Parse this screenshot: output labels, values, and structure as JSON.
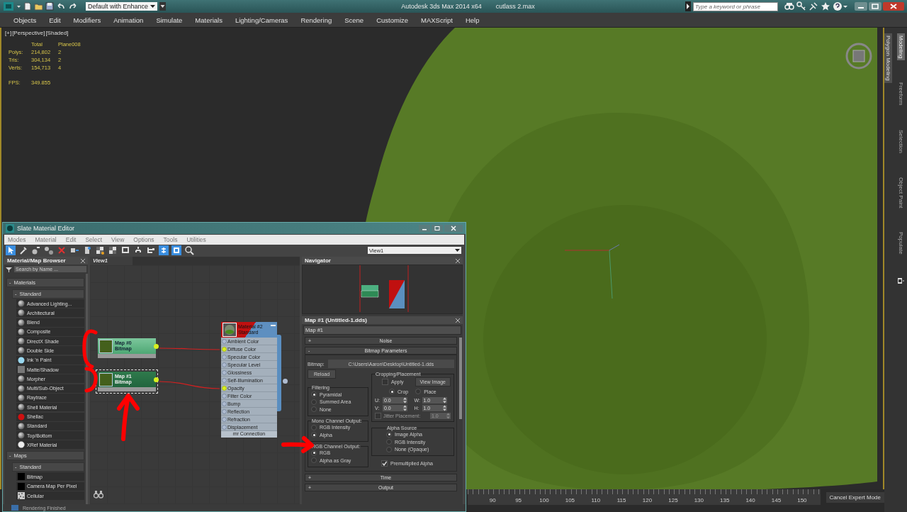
{
  "title_bar": {
    "workspace": "Default with Enhance",
    "title": "Autodesk 3ds Max  2014 x64",
    "file": "cutlass 2.max",
    "search": {
      "placeholder": "Type a keyword or phrase"
    }
  },
  "menu_bar": [
    "Objects",
    "Edit",
    "Modifiers",
    "Animation",
    "Simulate",
    "Materials",
    "Lighting/Cameras",
    "Rendering",
    "Scene",
    "Customize",
    "MAXScript",
    "Help"
  ],
  "viewport": {
    "labels": [
      "[+]",
      "[Perspective]",
      "[Shaded]"
    ],
    "stats": {
      "columns": [
        "Total",
        "Plane008"
      ],
      "rows": [
        {
          "label": "Polys:",
          "total": "214,802",
          "selection": "2"
        },
        {
          "label": "Tris:",
          "total": "304,134",
          "selection": "2"
        },
        {
          "label": "Verts:",
          "total": "154,713",
          "selection": "4"
        }
      ]
    },
    "fps": {
      "label": "FPS:",
      "value": "349.855"
    }
  },
  "ribbon_panel": "Polygon Modeling",
  "command_tabs": [
    {
      "label": "Modeling",
      "selected": true
    },
    {
      "label": "Freeform",
      "selected": false
    },
    {
      "label": "Selection",
      "selected": false
    },
    {
      "label": "Object Paint",
      "selected": false
    },
    {
      "label": "Populate",
      "selected": false
    }
  ],
  "timeline": {
    "ticks": [
      "90",
      "95",
      "100",
      "105",
      "110",
      "115",
      "120",
      "125",
      "130",
      "135",
      "140",
      "145",
      "150"
    ]
  },
  "expert_mode_button": "Cancel Expert Mode",
  "material_editor": {
    "title": "Slate Material Editor",
    "menu": [
      "Modes",
      "Material",
      "Edit",
      "Select",
      "View",
      "Options",
      "Tools",
      "Utilities"
    ],
    "view_dropdown": "View1",
    "browser": {
      "title": "Material/Map Browser",
      "search_placeholder": "Search by Name ...",
      "tree": [
        {
          "label": "Materials",
          "sign": "-",
          "children": [
            {
              "label": "Standard",
              "sign": "-",
              "children": [
                {
                  "label": "Advanced Lighting...",
                  "kind": "sphere"
                },
                {
                  "label": "Architectural",
                  "kind": "sphere"
                },
                {
                  "label": "Blend",
                  "kind": "sphere"
                },
                {
                  "label": "Composite",
                  "kind": "sphere"
                },
                {
                  "label": "DirectX Shade",
                  "kind": "sphere"
                },
                {
                  "label": "Double Side",
                  "kind": "sphere"
                },
                {
                  "label": "Ink 'n Paint",
                  "kind": "flat-sphere"
                },
                {
                  "label": "Matte/Shadow",
                  "kind": "square"
                },
                {
                  "label": "Morpher",
                  "kind": "sphere"
                },
                {
                  "label": "Multi/Sub-Object",
                  "kind": "sphere"
                },
                {
                  "label": "Raytrace",
                  "kind": "sphere"
                },
                {
                  "label": "Shell Material",
                  "kind": "sphere"
                },
                {
                  "label": "Shellac",
                  "kind": "red-sphere"
                },
                {
                  "label": "Standard",
                  "kind": "sphere"
                },
                {
                  "label": "Top/Bottom",
                  "kind": "sphere"
                },
                {
                  "label": "XRef Material",
                  "kind": "white-sphere"
                }
              ]
            }
          ]
        },
        {
          "label": "Maps",
          "sign": "-",
          "children": [
            {
              "label": "Standard",
              "sign": "-",
              "children": [
                {
                  "label": "Bitmap",
                  "kind": "black"
                },
                {
                  "label": "Camera Map Per Pixel",
                  "kind": "black"
                },
                {
                  "label": "Cellular",
                  "kind": "noise"
                }
              ]
            }
          ]
        }
      ]
    },
    "view_tab": "View1",
    "map_nodes": [
      {
        "title": "Map #0",
        "subtitle": "Bitmap",
        "selected": false
      },
      {
        "title": "Map #1",
        "subtitle": "Bitmap",
        "selected": true
      }
    ],
    "material_node": {
      "title": "Material #2",
      "subtitle": "Standard",
      "footer": "mr Connection",
      "slots": [
        {
          "label": "Ambient Color",
          "connected": false
        },
        {
          "label": "Diffuse Color",
          "connected": true
        },
        {
          "label": "Specular Color",
          "connected": false
        },
        {
          "label": "Specular Level",
          "connected": false
        },
        {
          "label": "Glossiness",
          "connected": false
        },
        {
          "label": "Self-Illumination",
          "connected": false
        },
        {
          "label": "Opacity",
          "connected": true
        },
        {
          "label": "Filter Color",
          "connected": false
        },
        {
          "label": "Bump",
          "connected": false
        },
        {
          "label": "Reflection",
          "connected": false
        },
        {
          "label": "Refraction",
          "connected": false
        },
        {
          "label": "Displacement",
          "connected": false
        }
      ]
    },
    "navigator": {
      "title": "Navigator"
    },
    "parameters": {
      "title": "Map #1 (Untitled-1.dds)",
      "name": "Map #1",
      "rollouts_before": [
        {
          "sign": "+",
          "label": "Noise"
        },
        {
          "sign": "-",
          "label": "Bitmap Parameters"
        }
      ],
      "bitmap_label": "Bitmap:",
      "bitmap_path": "C:\\Users\\Aaron\\Desktop\\Untitled-1.dds",
      "reload": "Reload",
      "filtering": {
        "title": "Filtering",
        "options": [
          {
            "label": "Pyramidal",
            "selected": true
          },
          {
            "label": "Summed Area",
            "selected": false
          },
          {
            "label": "None",
            "selected": false
          }
        ]
      },
      "mono_output": {
        "title": "Mono Channel Output:",
        "options": [
          {
            "label": "RGB Intensity",
            "selected": false
          },
          {
            "label": "Alpha",
            "selected": true
          }
        ]
      },
      "rgb_output": {
        "title": "RGB Channel Output:",
        "options": [
          {
            "label": "RGB",
            "selected": true
          },
          {
            "label": "Alpha as Gray",
            "selected": false
          }
        ]
      },
      "cropping": {
        "title": "Cropping/Placement",
        "apply": {
          "label": "Apply",
          "checked": false
        },
        "view_image": "View Image",
        "modes": [
          {
            "label": "Crop",
            "selected": true
          },
          {
            "label": "Place",
            "selected": false
          }
        ],
        "fields": [
          {
            "label": "U:",
            "value": "0.0"
          },
          {
            "label": "W:",
            "value": "1.0"
          },
          {
            "label": "V:",
            "value": "0.0"
          },
          {
            "label": "H:",
            "value": "1.0"
          }
        ],
        "jitter": {
          "label": "Jitter Placement:",
          "checked": false,
          "value": "1.0",
          "disabled": true
        }
      },
      "alpha_source": {
        "title": "Alpha Source",
        "options": [
          {
            "label": "Image Alpha",
            "selected": true
          },
          {
            "label": "RGB Intensity",
            "selected": false
          },
          {
            "label": "None (Opaque)",
            "selected": false
          }
        ]
      },
      "premultiplied": {
        "label": "Premultiplied Alpha",
        "checked": true
      },
      "rollouts_after": [
        {
          "sign": "+",
          "label": "Time"
        },
        {
          "sign": "+",
          "label": "Output"
        }
      ]
    },
    "status": "Rendering Finished"
  }
}
